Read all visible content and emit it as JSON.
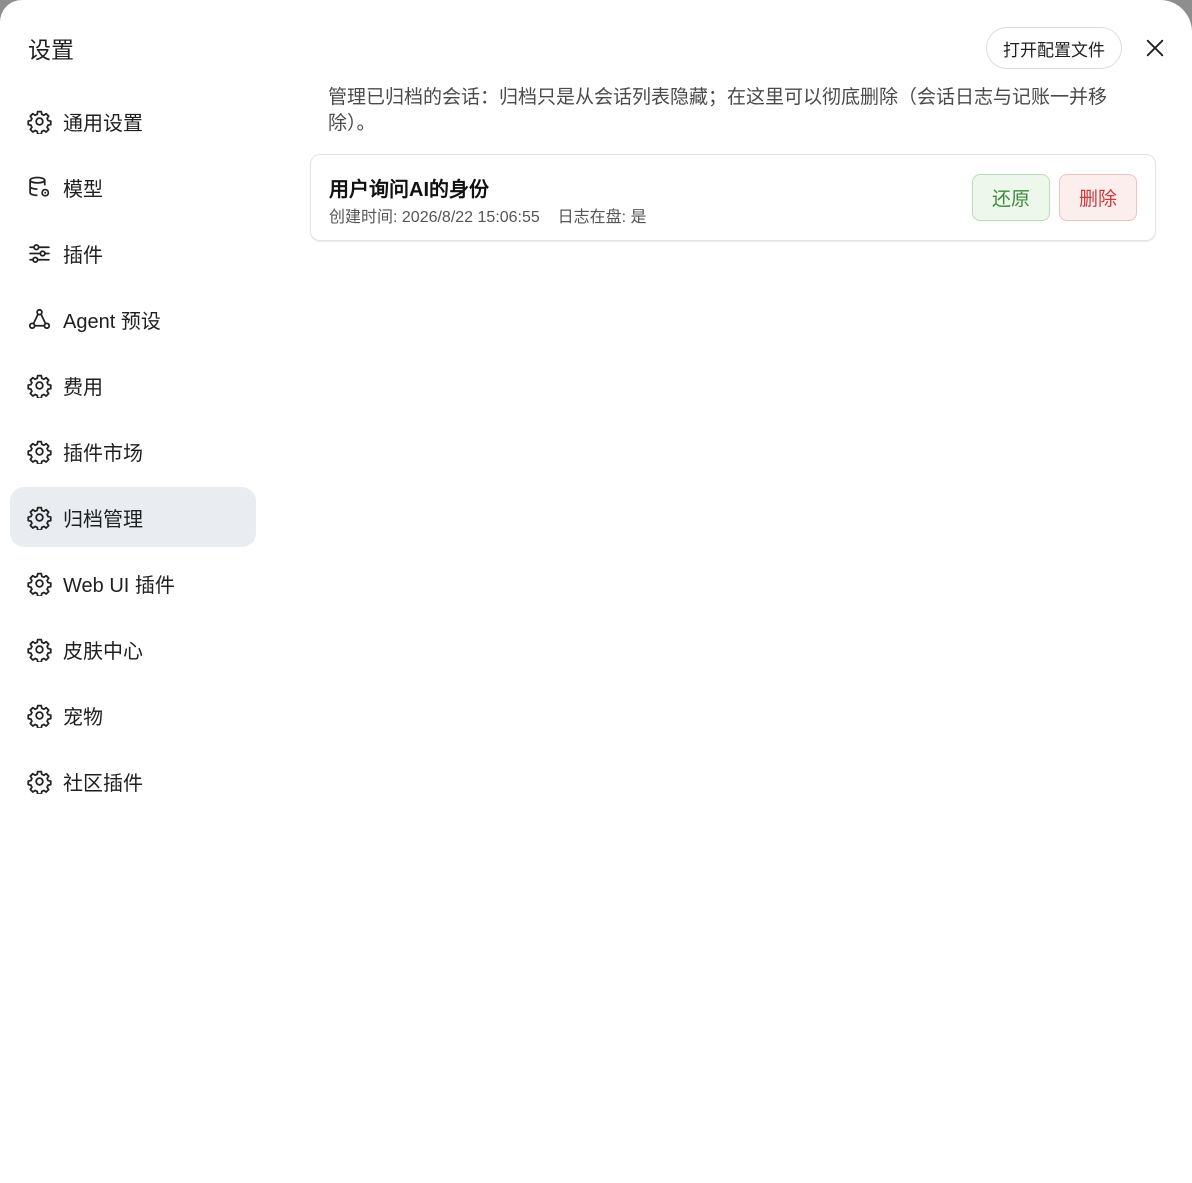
{
  "dialog": {
    "title": "设置",
    "open_config_label": "打开配置文件"
  },
  "sidebar": {
    "items": [
      {
        "label": "通用设置",
        "icon": "gear-icon",
        "active": false
      },
      {
        "label": "模型",
        "icon": "database-gear-icon",
        "active": false
      },
      {
        "label": "插件",
        "icon": "sliders-icon",
        "active": false
      },
      {
        "label": "Agent 预设",
        "icon": "agent-nodes-icon",
        "active": false
      },
      {
        "label": "费用",
        "icon": "gear-icon",
        "active": false
      },
      {
        "label": "插件市场",
        "icon": "gear-icon",
        "active": false
      },
      {
        "label": "归档管理",
        "icon": "gear-icon",
        "active": true
      },
      {
        "label": "Web UI 插件",
        "icon": "gear-icon",
        "active": false
      },
      {
        "label": "皮肤中心",
        "icon": "gear-icon",
        "active": false
      },
      {
        "label": "宠物",
        "icon": "gear-icon",
        "active": false
      },
      {
        "label": "社区插件",
        "icon": "gear-icon",
        "active": false
      }
    ]
  },
  "main": {
    "description": "管理已归档的会话：归档只是从会话列表隐藏；在这里可以彻底删除（会话日志与记账一并移除）。",
    "archives": [
      {
        "title": "用户询问AI的身份",
        "created_label": "创建时间: 2026/8/22 15:06:55",
        "log_label": "日志在盘: 是",
        "restore_label": "还原",
        "delete_label": "删除"
      }
    ]
  },
  "colors": {
    "active_bg": "#e9edf2",
    "restore": "#3f8a3c",
    "delete": "#cc3b3b"
  }
}
